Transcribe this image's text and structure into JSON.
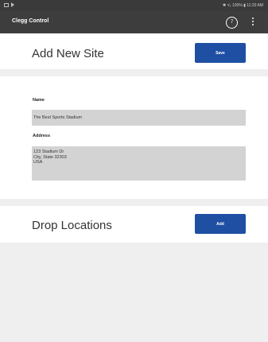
{
  "status_bar": {
    "right_text": "✱ ⁵⁄₆ 100% ▮ 11:20 AM"
  },
  "app_bar": {
    "title": "Clegg Control",
    "badge_count": "7",
    "menu_icon": "more-vert-icon"
  },
  "header": {
    "title": "Add New Site",
    "save_label": "Save"
  },
  "form": {
    "name_label": "Name",
    "name_value": "The Best Sports Stadium",
    "address_label": "Address",
    "address_lines": [
      "123 Stadium Dr",
      "City, State 32303",
      "USA"
    ]
  },
  "drop_locations": {
    "title": "Drop Locations",
    "add_label": "Add"
  },
  "colors": {
    "accent": "#1e4fa3",
    "app_bar": "#3d3d3d",
    "field_bg": "#d3d3d3"
  }
}
